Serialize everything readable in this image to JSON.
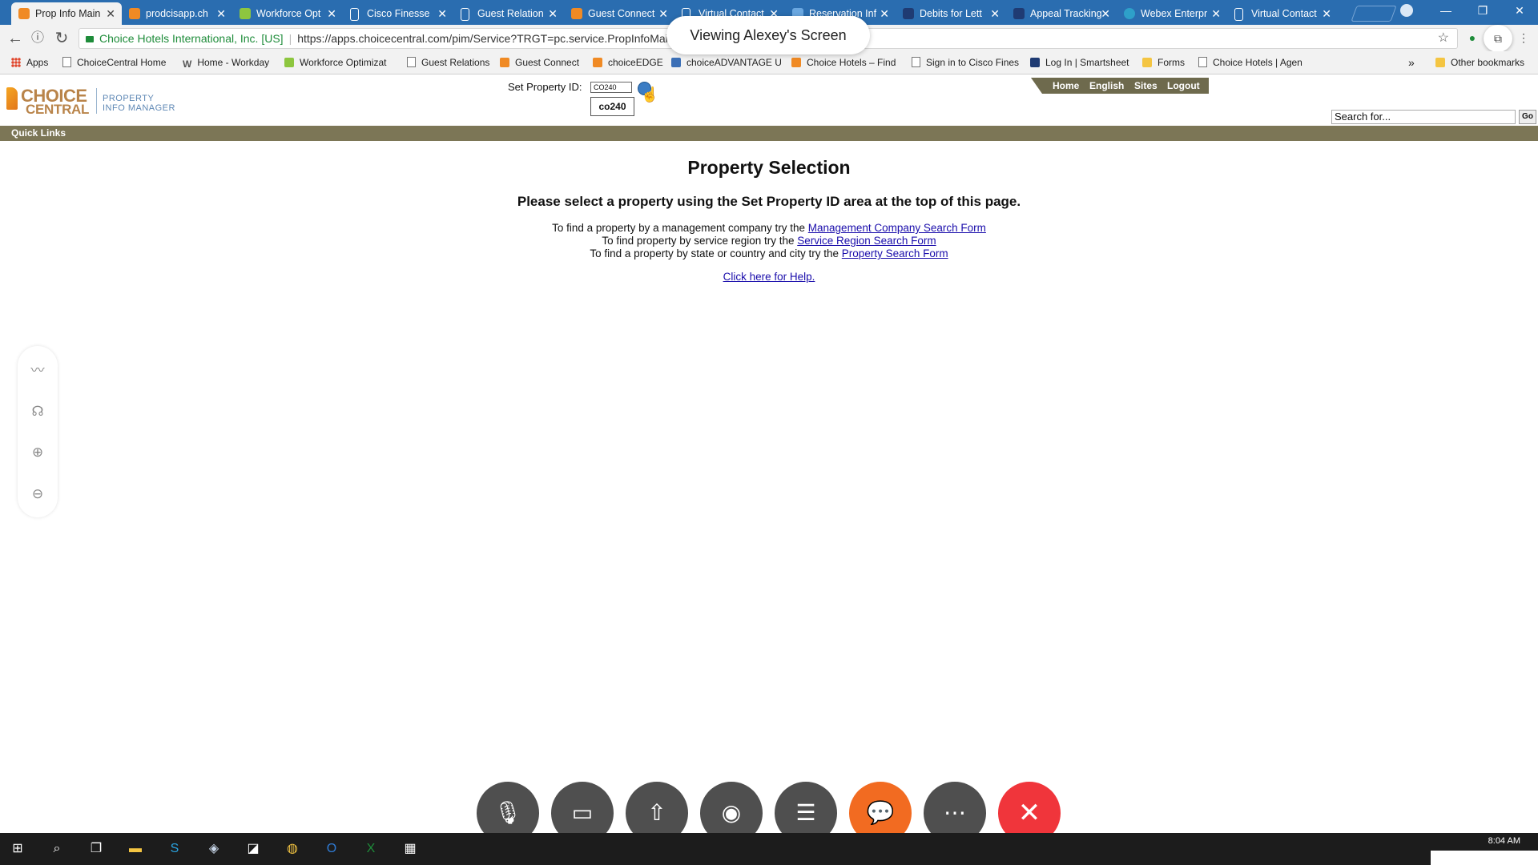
{
  "browser": {
    "tabs": [
      {
        "label": "Prop Info Main",
        "icon": "choice-icon",
        "color": "#f08a24",
        "active": true
      },
      {
        "label": "prodcisapp.ch",
        "icon": "choice-icon",
        "color": "#f08a24"
      },
      {
        "label": "Workforce Opt",
        "icon": "workforce-icon",
        "color": "#8dc63f"
      },
      {
        "label": "Cisco Finesse",
        "icon": "page-icon",
        "color": "#ffffff"
      },
      {
        "label": "Guest Relation",
        "icon": "page-icon",
        "color": "#ffffff"
      },
      {
        "label": "Guest Connect",
        "icon": "choice-icon",
        "color": "#f08a24"
      },
      {
        "label": "Virtual Contact",
        "icon": "page-icon",
        "color": "#ffffff"
      },
      {
        "label": "Reservation Inf",
        "icon": "choiceadvantage-icon",
        "color": "#6aa7e0"
      },
      {
        "label": "Debits for Lett",
        "icon": "smartsheet-icon",
        "color": "#1f3b73"
      },
      {
        "label": "Appeal Tracking",
        "icon": "smartsheet-icon",
        "color": "#1f3b73"
      },
      {
        "label": "Webex Enterpr",
        "icon": "webex-icon",
        "color": "#2ea0c9"
      },
      {
        "label": "Virtual Contact",
        "icon": "page-icon",
        "color": "#ffffff"
      }
    ],
    "address": {
      "secure_label": "Choice Hotels International, Inc. [US]",
      "url": "https://apps.choicecentral.com/pim/Service?TRGT=pc.service.PropInfoMain"
    },
    "bookmarks": [
      {
        "label": "Apps",
        "icon": "apps-grid-icon"
      },
      {
        "label": "ChoiceCentral Home",
        "icon": "page-icon"
      },
      {
        "label": "Home - Workday",
        "icon": "workday-icon"
      },
      {
        "label": "Workforce Optimizat",
        "icon": "workforce-icon"
      },
      {
        "label": "Guest Relations",
        "icon": "page-icon"
      },
      {
        "label": "Guest Connect",
        "icon": "choice-icon"
      },
      {
        "label": "choiceEDGE",
        "icon": "choice-icon"
      },
      {
        "label": "choiceADVANTAGE U",
        "icon": "choiceadvantage-icon"
      },
      {
        "label": "Choice Hotels – Find",
        "icon": "choice-icon"
      },
      {
        "label": "Sign in to Cisco Fines",
        "icon": "page-icon"
      },
      {
        "label": "Log In | Smartsheet",
        "icon": "smartsheet-icon"
      },
      {
        "label": "Forms",
        "icon": "folder-icon"
      },
      {
        "label": "Choice Hotels | Agen",
        "icon": "page-icon"
      }
    ],
    "bookmarks_overflow": "»",
    "other_bookmarks": "Other bookmarks"
  },
  "webex": {
    "viewing_banner": "Viewing Alexey's Screen",
    "side_tools": [
      "annotate-icon",
      "remote-control-icon",
      "zoom-in-icon",
      "zoom-out-icon"
    ],
    "controls": [
      "mute-icon",
      "video-icon",
      "share-icon",
      "record-icon",
      "participants-icon",
      "chat-icon",
      "more-icon",
      "end-call-icon"
    ]
  },
  "page": {
    "logo": {
      "line1": "CHOICE",
      "line2": "CENTRAL",
      "sub1": "PROPERTY",
      "sub2": "INFO MANAGER"
    },
    "set_property_label": "Set Property ID:",
    "property_input_value": "CO240",
    "autocomplete_suggestion": "co240",
    "nav": [
      "Home",
      "English",
      "Sites",
      "Logout"
    ],
    "search_placeholder": "Search for...",
    "go_label": "Go",
    "quick_links": "Quick Links",
    "title": "Property Selection",
    "instruction": "Please select a property using the Set Property ID area at the top of this page.",
    "lines": [
      {
        "prefix": "To find a property by a management company try the ",
        "link": "Management Company Search Form"
      },
      {
        "prefix": "To find property by service region try the ",
        "link": "Service Region Search Form"
      },
      {
        "prefix": "To find a property by state or country and city try the ",
        "link": "Property Search Form"
      }
    ],
    "help_link": "Click here for Help."
  },
  "taskbar": {
    "clock": "8:04 AM",
    "apps": [
      "windows-start-icon",
      "search-icon",
      "task-view-icon",
      "file-explorer-icon",
      "skype-icon",
      "app-icon",
      "sticky-notes-icon",
      "chrome-icon",
      "outlook-icon",
      "excel-icon",
      "calculator-icon"
    ]
  }
}
